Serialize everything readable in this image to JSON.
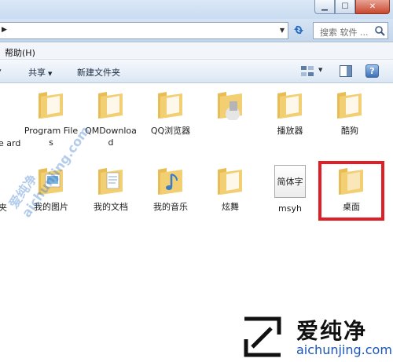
{
  "window": {
    "minimize": "▁",
    "maximize": "☐",
    "close": "✕"
  },
  "address": {
    "arrow": "▶",
    "dropdown": "▼"
  },
  "search": {
    "placeholder": "搜索 软件 ..."
  },
  "menu": {
    "help": "帮助(H)"
  },
  "toolbar": {
    "share": "共享",
    "new_folder": "新建文件夹"
  },
  "row1": [
    {
      "name": "program-files",
      "label": "Program Files"
    },
    {
      "name": "qmdownload",
      "label": "QMDownload"
    },
    {
      "name": "qq-browser",
      "label": "QQ浏览器"
    },
    {
      "name": "player",
      "label": "播放器"
    },
    {
      "name": "kugou",
      "label": "酷狗"
    }
  ],
  "row1_partial": "e ard",
  "row2": [
    {
      "name": "my-pictures",
      "label": "我的图片"
    },
    {
      "name": "my-documents",
      "label": "我的文档"
    },
    {
      "name": "my-music",
      "label": "我的音乐"
    },
    {
      "name": "xuanwu",
      "label": "炫舞"
    },
    {
      "name": "msyh",
      "label": "msyh"
    },
    {
      "name": "desktop",
      "label": "桌面"
    }
  ],
  "row2_partial": "夹",
  "font_file_text": "简体字",
  "watermark": {
    "diagonal": "爱纯净 aichunjing.com",
    "name": "爱纯净",
    "url": "aichunjing.com"
  },
  "colors": {
    "highlight": "#e01e25",
    "folder": "#f2cf72",
    "brand_blue": "#1a55b8"
  }
}
